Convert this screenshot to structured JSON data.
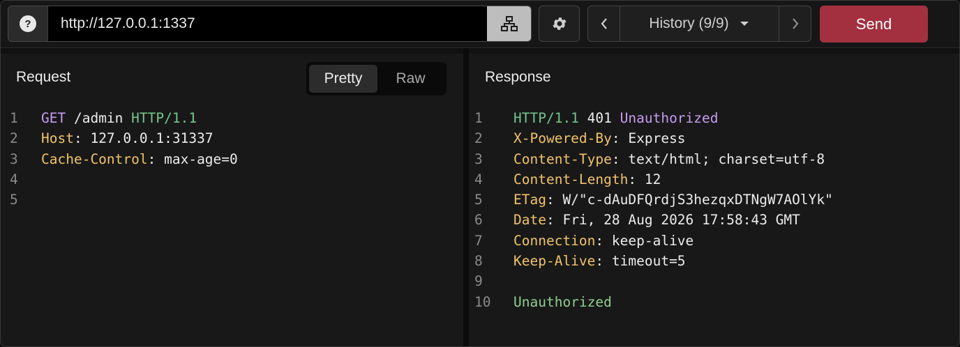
{
  "toolbar": {
    "url": "http://127.0.0.1:1337",
    "history_label": "History (9/9)",
    "send_label": "Send"
  },
  "request": {
    "title": "Request",
    "mode_pretty": "Pretty",
    "mode_raw": "Raw",
    "lines": [
      {
        "n": "1",
        "method": "GET",
        "path": " /admin ",
        "proto": "HTTP/1.1"
      },
      {
        "n": "2",
        "name": "Host",
        "value": ": 127.0.0.1:31337"
      },
      {
        "n": "3",
        "name": "Cache-Control",
        "value": ": max-age=0"
      },
      {
        "n": "4"
      },
      {
        "n": "5"
      }
    ]
  },
  "response": {
    "title": "Response",
    "status": {
      "n": "1",
      "proto": "HTTP/1.1",
      "code": " 401 ",
      "reason": "Unauthorized"
    },
    "headers": [
      {
        "n": "2",
        "name": "X-Powered-By",
        "value": ": Express"
      },
      {
        "n": "3",
        "name": "Content-Type",
        "value": ": text/html; charset=utf-8"
      },
      {
        "n": "4",
        "name": "Content-Length",
        "value": ": 12"
      },
      {
        "n": "5",
        "name": "ETag",
        "value": ": W/\"c-dAuDFQrdjS3hezqxDTNgW7AOlYk\""
      },
      {
        "n": "6",
        "name": "Date",
        "value": ": Fri, 28 Aug 2026 17:58:43 GMT"
      },
      {
        "n": "7",
        "name": "Connection",
        "value": ": keep-alive"
      },
      {
        "n": "8",
        "name": "Keep-Alive",
        "value": ": timeout=5"
      }
    ],
    "blank_line": "9",
    "body_line": "10",
    "body": "Unauthorized"
  },
  "colors": {
    "send": "#a3303f",
    "method": "#c79cf0",
    "protocol": "#76c58d",
    "header_name": "#f0c36a",
    "body": "#8fcf8f"
  },
  "icons": [
    "help-icon",
    "network-icon",
    "gear-icon",
    "chevron-left-icon",
    "caret-down-icon",
    "chevron-right-icon"
  ]
}
